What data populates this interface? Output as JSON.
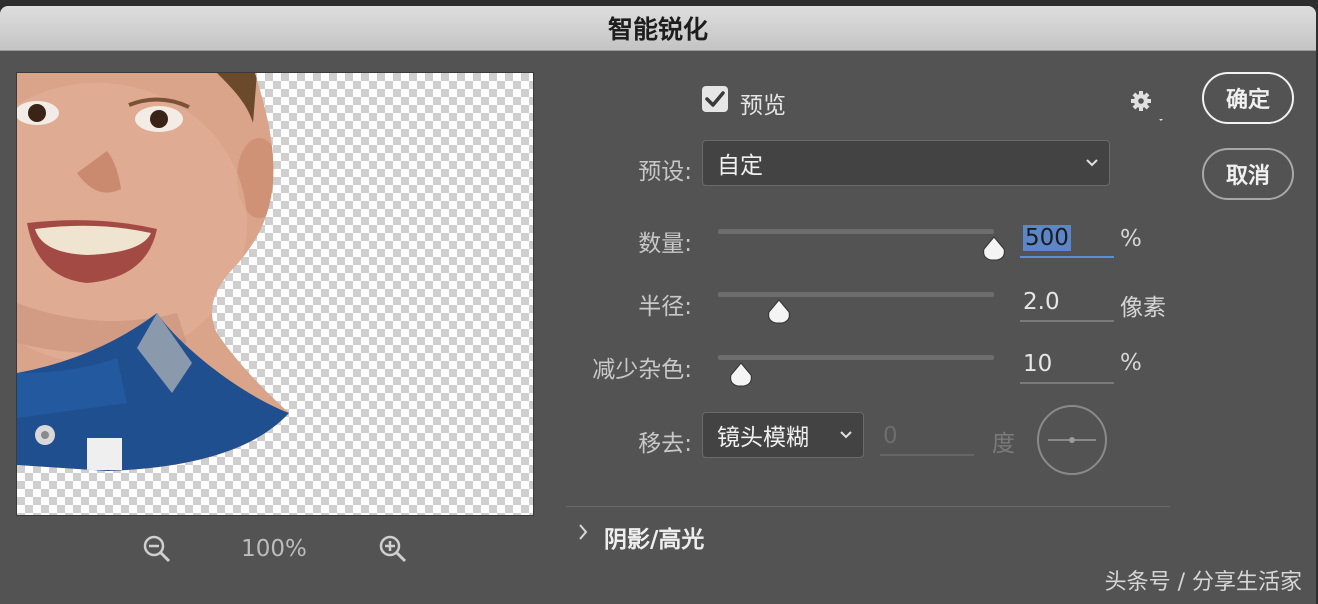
{
  "dialog": {
    "title": "智能锐化"
  },
  "preview_panel": {
    "zoom_level": "100%"
  },
  "options": {
    "preview_checkbox": {
      "label": "预览",
      "checked": true
    },
    "preset": {
      "label": "预设:",
      "value": "自定"
    },
    "amount": {
      "label": "数量:",
      "value": "500",
      "unit": "%",
      "min": 1,
      "max": 500,
      "current": 500
    },
    "radius": {
      "label": "半径:",
      "value": "2.0",
      "unit": "像素",
      "min": 0.1,
      "max": 64,
      "current": 2.0
    },
    "reduce_noise": {
      "label": "减少杂色:",
      "value": "10",
      "unit": "%",
      "min": 0,
      "max": 100,
      "current": 10
    },
    "remove": {
      "label": "移去:",
      "value": "镜头模糊",
      "angle_value": "0",
      "angle_unit": "度"
    },
    "shadows_highlights": {
      "label": "阴影/高光"
    }
  },
  "buttons": {
    "ok": "确定",
    "cancel": "取消"
  },
  "watermark": "头条号 / 分享生活家",
  "colors": {
    "dialog_bg": "#535353",
    "active_field_underline": "#5d8ed6"
  }
}
